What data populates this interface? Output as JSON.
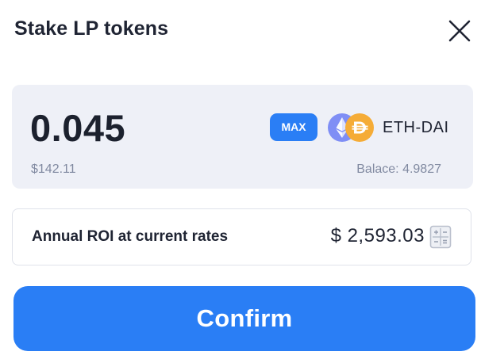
{
  "header": {
    "title": "Stake LP tokens",
    "close_icon": "close-icon"
  },
  "stake": {
    "amount": "0.045",
    "usd_value": "$142.11",
    "max_label": "MAX",
    "pair": "ETH-DAI",
    "balance": "Balace: 4.9827",
    "token_icons": [
      "ethereum-icon",
      "dai-icon"
    ]
  },
  "roi": {
    "label": "Annual ROI at current rates",
    "value": "$ 2,593.03",
    "icon": "calculator-icon"
  },
  "confirm_label": "Confirm",
  "colors": {
    "accent": "#2a7ef5",
    "panel_bg": "#eef0f7",
    "eth_purple": "#7f8ef5",
    "dai_yellow": "#f5ac37",
    "text_primary": "#1f2433",
    "text_muted": "#8089a0"
  }
}
